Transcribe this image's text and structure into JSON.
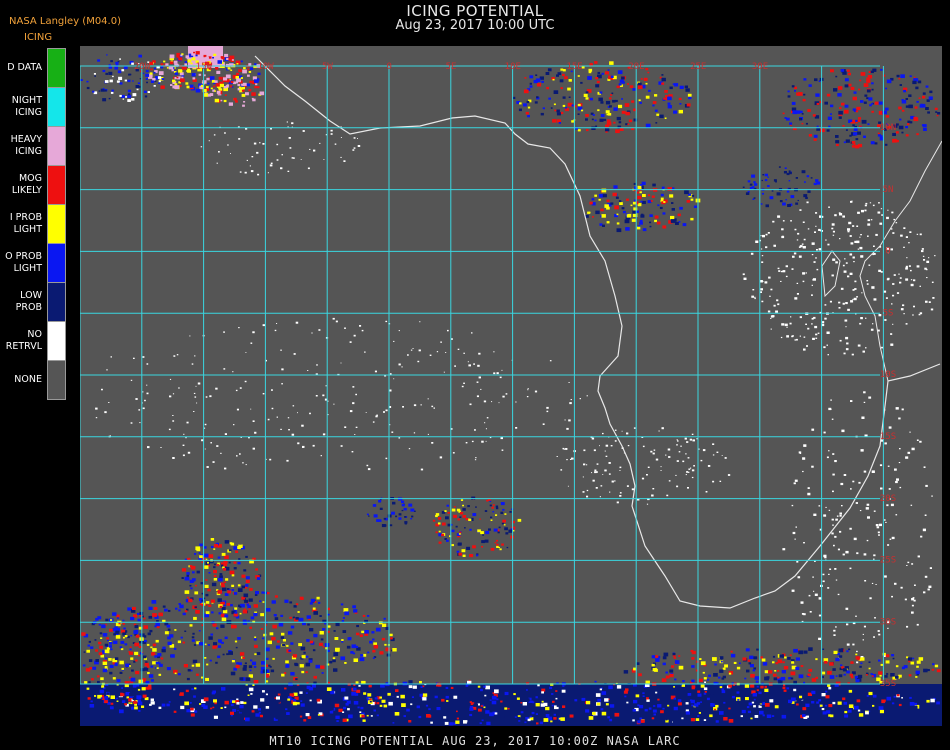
{
  "header": {
    "title": "ICING POTENTIAL",
    "subtitle": "Aug 23, 2017 10:00 UTC",
    "provider": "NASA Langley (M04.0)",
    "legend_title": "ICING"
  },
  "legend": [
    {
      "label": "D DATA",
      "color": "#17b015"
    },
    {
      "label": "NIGHT\nICING",
      "color": "#14e6ea"
    },
    {
      "label": "HEAVY\nICING",
      "color": "#e6a8d8"
    },
    {
      "label": "MOG\nLIKELY",
      "color": "#ee1010"
    },
    {
      "label": "I PROB\nLIGHT",
      "color": "#ffff00"
    },
    {
      "label": "O PROB\nLIGHT",
      "color": "#0a17f2"
    },
    {
      "label": "LOW\nPROB",
      "color": "#0a1a72"
    },
    {
      "label": "NO\nRETRVL",
      "color": "#ffffff"
    },
    {
      "label": "NONE",
      "color": "#555555"
    }
  ],
  "map": {
    "background": "#555555",
    "grid_color": "#3ad6e0",
    "label_color": "#c83030",
    "coastline_color": "#e8e8e8",
    "lon_labels": [
      "20W",
      "15W",
      "10W",
      "5W",
      "0",
      "5E",
      "10E",
      "15E",
      "20E",
      "25E",
      "30E"
    ],
    "lat_labels": [
      "10N",
      "5N",
      "0",
      "5S",
      "10S",
      "15S",
      "20S",
      "25S",
      "30S",
      "35S",
      "40S"
    ]
  },
  "footer": "MT10  ICING POTENTIAL   AUG 23, 2017 10:00Z   NASA LARC"
}
